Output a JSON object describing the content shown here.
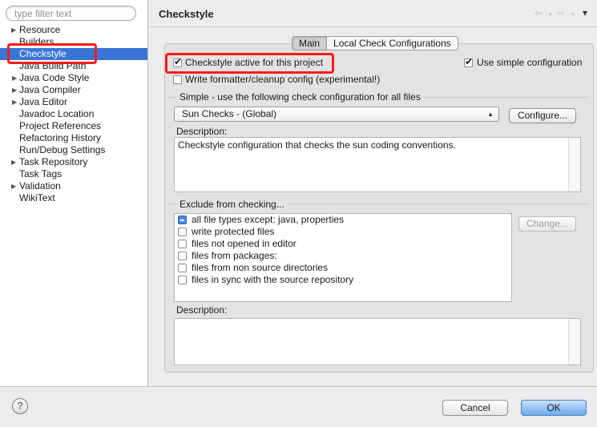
{
  "filter": {
    "placeholder": "type filter text"
  },
  "tree": [
    {
      "label": "Resource",
      "expandable": true
    },
    {
      "label": "Builders",
      "expandable": false
    },
    {
      "label": "Checkstyle",
      "expandable": false,
      "selected": true
    },
    {
      "label": "Java Build Path",
      "expandable": false
    },
    {
      "label": "Java Code Style",
      "expandable": true
    },
    {
      "label": "Java Compiler",
      "expandable": true
    },
    {
      "label": "Java Editor",
      "expandable": true
    },
    {
      "label": "Javadoc Location",
      "expandable": false
    },
    {
      "label": "Project References",
      "expandable": false
    },
    {
      "label": "Refactoring History",
      "expandable": false
    },
    {
      "label": "Run/Debug Settings",
      "expandable": false
    },
    {
      "label": "Task Repository",
      "expandable": true
    },
    {
      "label": "Task Tags",
      "expandable": false
    },
    {
      "label": "Validation",
      "expandable": true
    },
    {
      "label": "WikiText",
      "expandable": false
    }
  ],
  "page": {
    "title": "Checkstyle",
    "nav": {
      "back": "⇦",
      "forward": "⇨",
      "menu": "▾"
    }
  },
  "tabs": [
    {
      "label": "Main",
      "active": true
    },
    {
      "label": "Local Check Configurations",
      "active": false
    }
  ],
  "main": {
    "active_label": "Checkstyle active for this project",
    "active_checked": true,
    "simple_config_label": "Use simple configuration",
    "simple_config_checked": true,
    "formatter_label": "Write formatter/cleanup config (experimental!)",
    "formatter_checked": false,
    "simple_section_label": "Simple - use the following check configuration for all files",
    "config_selected": "Sun Checks  - (Global)",
    "configure_button": "Configure...",
    "description_label": "Description:",
    "description_text": "Checkstyle configuration that checks the sun coding conventions.",
    "exclude_label": "Exclude from checking...",
    "exclude_items": [
      {
        "label": "all file types except: java, properties",
        "state": "partial"
      },
      {
        "label": "write protected files",
        "state": "unchecked"
      },
      {
        "label": "files not opened in editor",
        "state": "unchecked"
      },
      {
        "label": "files from packages:",
        "state": "unchecked"
      },
      {
        "label": "files from non source directories",
        "state": "unchecked"
      },
      {
        "label": "files in sync with the source repository",
        "state": "unchecked"
      }
    ],
    "change_button": "Change...",
    "description2_label": "Description:"
  },
  "footer": {
    "help": "?",
    "cancel": "Cancel",
    "ok": "OK"
  },
  "colors": {
    "selection": "#3875d7",
    "highlight": "#ff1a1a"
  }
}
